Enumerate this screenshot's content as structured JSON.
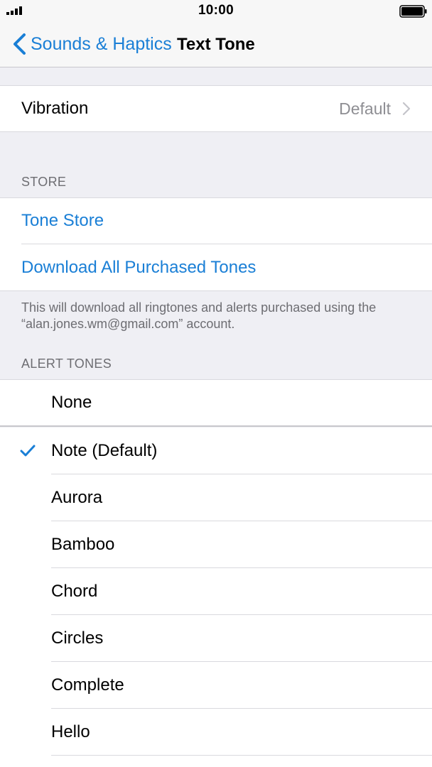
{
  "status": {
    "time": "10:00"
  },
  "nav": {
    "back_label": "Sounds & Haptics",
    "title": "Text Tone"
  },
  "vibration": {
    "label": "Vibration",
    "value": "Default"
  },
  "store": {
    "header": "STORE",
    "tone_store": "Tone Store",
    "download_all": "Download All Purchased Tones",
    "note": "This will download all ringtones and alerts purchased using the “alan.jones.wm@gmail.com” account."
  },
  "alert_tones": {
    "header": "ALERT TONES",
    "none": "None",
    "items": [
      {
        "label": "Note (Default)",
        "selected": true
      },
      {
        "label": "Aurora"
      },
      {
        "label": "Bamboo"
      },
      {
        "label": "Chord"
      },
      {
        "label": "Circles"
      },
      {
        "label": "Complete"
      },
      {
        "label": "Hello"
      }
    ]
  },
  "colors": {
    "accent": "#1a7fd6",
    "background": "#efeff4",
    "secondary_text": "#8e8e93"
  }
}
